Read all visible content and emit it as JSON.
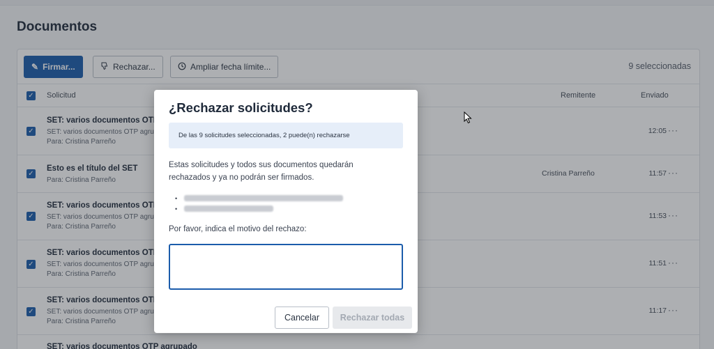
{
  "page": {
    "title": "Documentos"
  },
  "toolbar": {
    "sign_label": "Firmar...",
    "reject_label": "Rechazar...",
    "extend_label": "Ampliar fecha límite...",
    "selection_count": "9 seleccionadas"
  },
  "table": {
    "headers": {
      "request": "Solicitud",
      "sender": "Remitente",
      "sent": "Enviado"
    },
    "rows": [
      {
        "title": "SET: varios documentos OTP agrupado",
        "subtitle": "SET: varios documentos OTP agrupado",
        "recipient": "Para: Cristina Parreño",
        "sender": "",
        "time": "12:05",
        "checked": true
      },
      {
        "title": "Esto es el título del SET",
        "subtitle": "",
        "recipient": "Para: Cristina Parreño",
        "sender": "Cristina Parreño",
        "time": "11:57",
        "checked": true
      },
      {
        "title": "SET: varios documentos OTP agrupado",
        "subtitle": "SET: varios documentos OTP agrupado",
        "recipient": "Para: Cristina Parreño",
        "sender": "",
        "time": "11:53",
        "checked": true
      },
      {
        "title": "SET: varios documentos OTP agrupado",
        "subtitle": "SET: varios documentos OTP agrupado",
        "recipient": "Para: Cristina Parreño",
        "sender": "",
        "time": "11:51",
        "checked": true
      },
      {
        "title": "SET: varios documentos OTP agrupado",
        "subtitle": "SET: varios documentos OTP agrupado",
        "recipient": "Para: Cristina Parreño",
        "sender": "",
        "time": "11:17",
        "checked": true
      },
      {
        "title": "SET: varios documentos OTP agrupado",
        "subtitle": "",
        "recipient": "",
        "sender": "",
        "time": "",
        "checked": true
      }
    ]
  },
  "modal": {
    "title": "¿Rechazar solicitudes?",
    "info": "De las 9 solicitudes seleccionadas, 2 puede(n) rechazarse",
    "description": "Estas solicitudes y todos sus documentos quedarán rechazados y ya no podrán ser firmados.",
    "reason_label": "Por favor, indica el motivo del rechazo:",
    "reason_value": "",
    "cancel_label": "Cancelar",
    "reject_all_label": "Rechazar todas"
  },
  "colors": {
    "primary": "#1b5cab",
    "info_bg": "#e6eef9",
    "disabled_text": "#a3a9b2"
  },
  "icons": {
    "sign": "pen-icon",
    "reject": "thumbs-down-icon",
    "extend": "clock-icon",
    "more": "more-icon",
    "check": "check-icon"
  }
}
